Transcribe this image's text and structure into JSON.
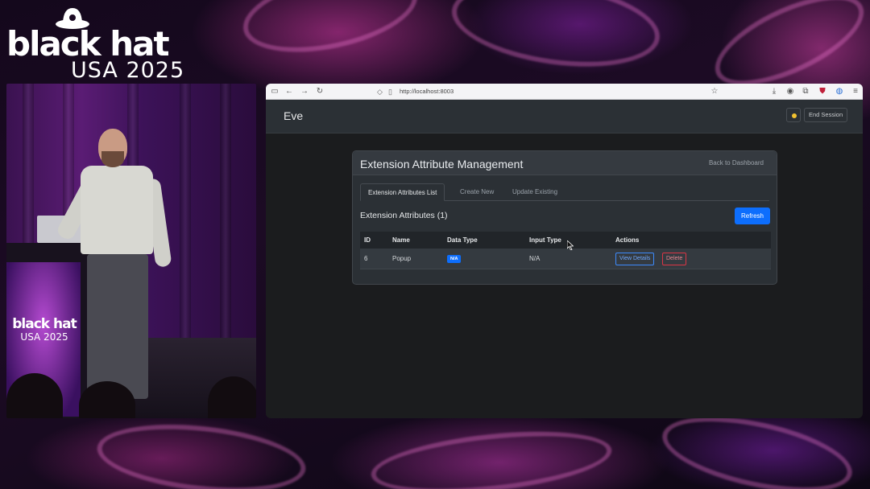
{
  "event": {
    "logo_word": "black hat",
    "logo_sub": "USA 2025",
    "podium_word": "black hat",
    "podium_sub": "USA 2025"
  },
  "browser": {
    "url": "http://localhost:8003"
  },
  "app": {
    "brand": "Eve",
    "end_session_label": "End Session",
    "theme_toggle_icon": "sun-icon",
    "card_title": "Extension Attribute Management",
    "back_label": "Back to Dashboard",
    "tabs": [
      {
        "label": "Extension Attributes List",
        "active": true
      },
      {
        "label": "Create New",
        "active": false
      },
      {
        "label": "Update Existing",
        "active": false
      }
    ],
    "section_title": "Extension Attributes (1)",
    "refresh_label": "Refresh",
    "table": {
      "columns": [
        "ID",
        "Name",
        "Data Type",
        "Input Type",
        "Actions"
      ],
      "rows": [
        {
          "id": "6",
          "name": "Popup",
          "data_type": "N/A",
          "input_type": "N/A",
          "view_label": "View Details",
          "delete_label": "Delete"
        }
      ]
    }
  },
  "colors": {
    "primary": "#0d6efd",
    "danger": "#dc3545",
    "surface": "#2b3035",
    "background": "#1b1c1e"
  }
}
